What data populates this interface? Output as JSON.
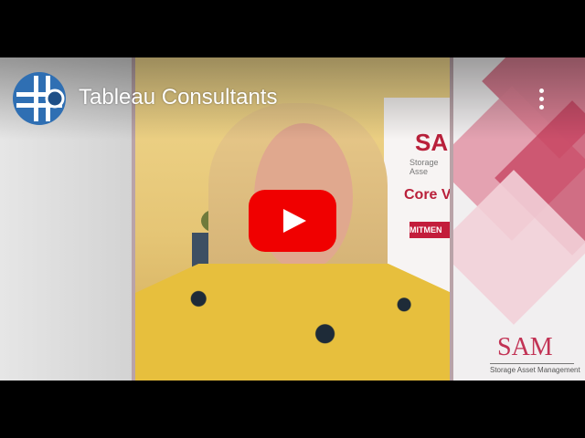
{
  "channel": {
    "title": "Tableau Consultants",
    "logo_icon": "channel-logo-icon"
  },
  "controls": {
    "more_icon": "vertical-dots-icon",
    "play_icon": "play-icon",
    "play_color": "#ff0000"
  },
  "banner": {
    "brand_partial": "SA",
    "tagline_partial": "Storage Asse",
    "heading_partial": "Core V",
    "band_partial": "MITMEN"
  },
  "branding": {
    "logo_text": "SAM",
    "logo_subtitle": "Storage Asset Management"
  },
  "colors": {
    "accent_red": "#c31d3b",
    "logo_pink": "#c23355"
  }
}
